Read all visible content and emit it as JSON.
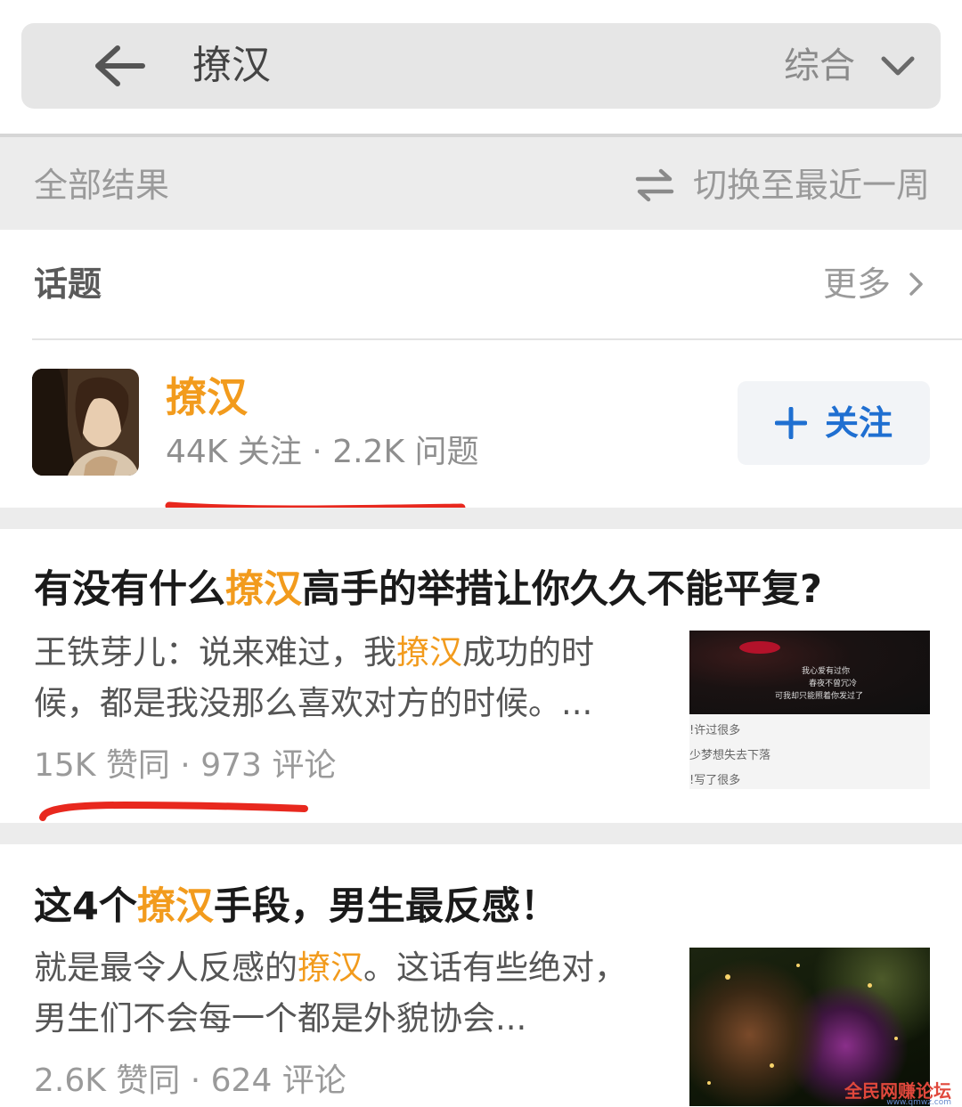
{
  "search": {
    "query": "撩汉",
    "sort_label": "综合"
  },
  "filter": {
    "all_results": "全部结果",
    "switch_label": "切换至最近一周"
  },
  "topic_section": {
    "heading": "话题",
    "more_label": "更多",
    "topic": {
      "name": "撩汉",
      "stats": "44K 关注 · 2.2K 问题",
      "follow_label": "关注"
    }
  },
  "cards": [
    {
      "title_pre": "有没有什么",
      "title_hl": "撩汉",
      "title_post": "高手的举措让你久久不能平复?",
      "excerpt_pre": "王铁芽儿：说来难过，我",
      "excerpt_hl": "撩汉",
      "excerpt_post": "成功的时候，都是我没那么喜欢对方的时候。...",
      "stats": "15K 赞同 · 973 评论",
      "thumb_lines_top": [
        "我心爱有过你",
        "春夜不曾冗冷",
        "可我却只能照着你发过了"
      ],
      "thumb_lines_bottom": [
        "!许过很多",
        "少梦想失去下落",
        "!写了很多"
      ]
    },
    {
      "title_pre": "这4个",
      "title_hl": "撩汉",
      "title_post": "手段，男生最反感！",
      "excerpt_pre": "就是最令人反感的",
      "excerpt_hl": "撩汉",
      "excerpt_post": "。这话有些绝对，男生们不会每一个都是外貌协会...",
      "stats": "2.6K 赞同 · 624 评论"
    }
  ],
  "watermark": {
    "text": "全民网赚论坛",
    "sub": "www.qmwz.com"
  },
  "colors": {
    "highlight": "#f29b1d",
    "follow_blue": "#1f6fd1",
    "annotation_red": "#e8281e"
  }
}
